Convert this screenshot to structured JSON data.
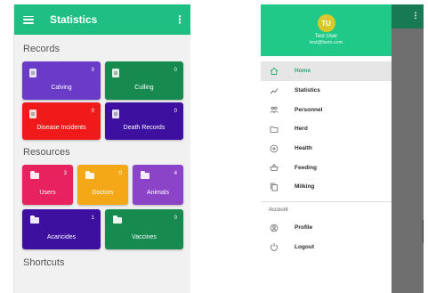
{
  "left_screen": {
    "app_title": "Statistics",
    "sections": {
      "records": "Records",
      "resources": "Resources",
      "shortcuts": "Shortcuts"
    },
    "records": [
      {
        "label": "Calving",
        "count": "0",
        "color": "#6a3bc6"
      },
      {
        "label": "Culling",
        "count": "0",
        "color": "#168a4f"
      },
      {
        "label": "Disease Incidents",
        "count": "0",
        "color": "#f11a1a"
      },
      {
        "label": "Death Records",
        "count": "0",
        "color": "#3e10a0"
      }
    ],
    "resources": [
      {
        "label": "Users",
        "count": "3",
        "color": "#e8215f"
      },
      {
        "label": "Doctors",
        "count": "0",
        "color": "#f5a817"
      },
      {
        "label": "Animals",
        "count": "4",
        "color": "#8b44c8"
      },
      {
        "label": "Acaricides",
        "count": "1",
        "color": "#3e10a0"
      },
      {
        "label": "Vaccines",
        "count": "0",
        "color": "#168a4f"
      }
    ]
  },
  "drawer": {
    "avatar_initials": "TU",
    "user_name": "Test User",
    "user_email": "test@farm.com",
    "nav_items": [
      {
        "label": "Home",
        "icon": "home-icon"
      },
      {
        "label": "Statistics",
        "icon": "trend-icon"
      },
      {
        "label": "Personnel",
        "icon": "people-icon"
      },
      {
        "label": "Herd",
        "icon": "folder-icon"
      },
      {
        "label": "Health",
        "icon": "plus-circle-icon"
      },
      {
        "label": "Feeding",
        "icon": "basket-icon"
      },
      {
        "label": "Milking",
        "icon": "copy-icon"
      }
    ],
    "account_label": "Account",
    "account_items": [
      {
        "label": "Profile",
        "icon": "user-circle-icon"
      },
      {
        "label": "Logout",
        "icon": "power-icon"
      }
    ]
  },
  "colors": {
    "accent": "#1fbe82",
    "drawer_header": "#20c988",
    "active_nav_text": "#1fae76",
    "scrim": "#6f6f6f"
  }
}
